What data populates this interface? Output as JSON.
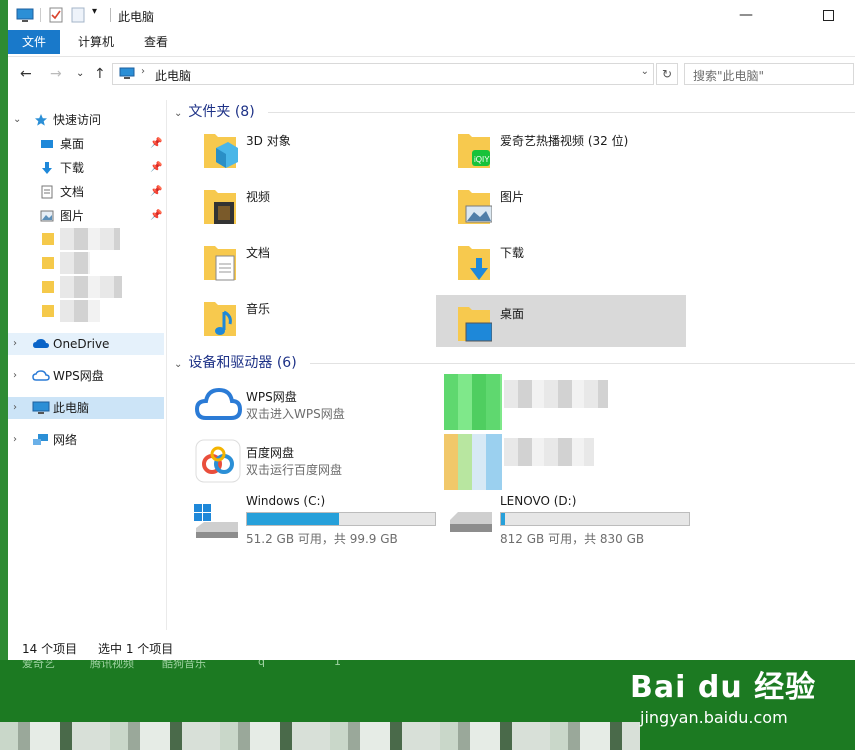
{
  "window": {
    "title": "此电脑"
  },
  "ribbon": {
    "tabs": [
      {
        "label": "文件",
        "active": true
      },
      {
        "label": "计算机"
      },
      {
        "label": "查看"
      }
    ]
  },
  "address": {
    "path": "此电脑",
    "search_placeholder": "搜索\"此电脑\""
  },
  "sidebar": {
    "quick_access": "快速访问",
    "quick_items": [
      {
        "label": "桌面"
      },
      {
        "label": "下载"
      },
      {
        "label": "文档"
      },
      {
        "label": "图片"
      }
    ],
    "onedrive": "OneDrive",
    "wps": "WPS网盘",
    "this_pc": "此电脑",
    "network": "网络"
  },
  "folders": {
    "heading": "文件夹 (8)",
    "items": [
      {
        "label": "3D 对象",
        "icon": "3d-objects-icon"
      },
      {
        "label": "爱奇艺热播视频 (32 位)",
        "icon": "iqiyi-icon"
      },
      {
        "label": "视频",
        "icon": "video-icon"
      },
      {
        "label": "图片",
        "icon": "picture-icon"
      },
      {
        "label": "文档",
        "icon": "document-icon"
      },
      {
        "label": "下载",
        "icon": "download-icon"
      },
      {
        "label": "音乐",
        "icon": "music-icon"
      },
      {
        "label": "桌面",
        "icon": "desktop-icon"
      }
    ]
  },
  "devices": {
    "heading": "设备和驱动器 (6)",
    "wps": {
      "label": "WPS网盘",
      "sub": "双击进入WPS网盘"
    },
    "baidu": {
      "label": "百度网盘",
      "sub": "双击运行百度网盘"
    },
    "drives": [
      {
        "label": "Windows (C:)",
        "info": "51.2 GB 可用，共 99.9 GB",
        "used_fraction": 0.49
      },
      {
        "label": "LENOVO (D:)",
        "info": "812 GB 可用，共 830 GB",
        "used_fraction": 0.02
      }
    ]
  },
  "status": {
    "count": "14 个项目",
    "selected": "选中 1 个项目"
  },
  "taskbar": {
    "labels": [
      "爱奇艺",
      "腾讯视频",
      "酷狗音乐",
      "q",
      "1"
    ]
  },
  "watermark": {
    "logo": "Bai du 经验",
    "url": "jingyan.baidu.com"
  },
  "colors": {
    "accent": "#1979ca",
    "selection": "#cce4f7",
    "group_heading": "#1e3287",
    "drive_bar": "#26a0da",
    "desktop": "#1d7a23"
  }
}
